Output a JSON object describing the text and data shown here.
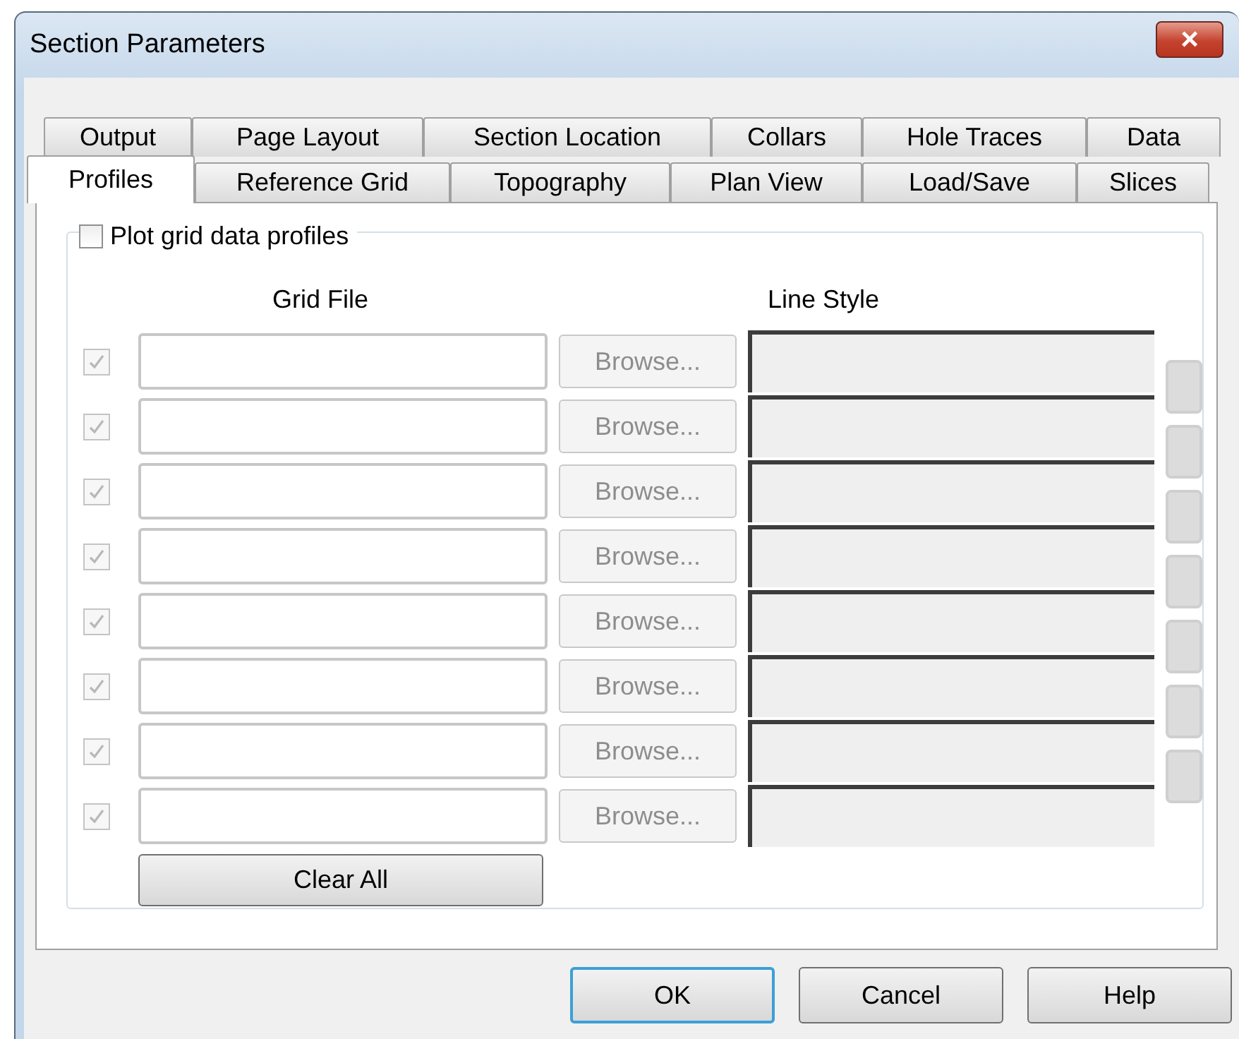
{
  "window": {
    "title": "Section Parameters",
    "close": "×"
  },
  "tab_rows": [
    [
      {
        "label": "Output",
        "selected": false
      },
      {
        "label": "Page Layout",
        "selected": false
      },
      {
        "label": "Section Location",
        "selected": false
      },
      {
        "label": "Collars",
        "selected": false
      },
      {
        "label": "Hole Traces",
        "selected": false
      },
      {
        "label": "Data",
        "selected": false
      }
    ],
    [
      {
        "label": "Profiles",
        "selected": true
      },
      {
        "label": "Reference Grid",
        "selected": false
      },
      {
        "label": "Topography",
        "selected": false
      },
      {
        "label": "Plan View",
        "selected": false
      },
      {
        "label": "Load/Save",
        "selected": false
      },
      {
        "label": "Slices",
        "selected": false
      }
    ]
  ],
  "group": {
    "label": "Plot grid data profiles",
    "checked": false
  },
  "columns": [
    "Grid File",
    "Line Style"
  ],
  "rows": [
    {
      "checked": true,
      "disabled": true,
      "browse": "Browse..."
    },
    {
      "checked": true,
      "disabled": true,
      "browse": "Browse..."
    },
    {
      "checked": true,
      "disabled": true,
      "browse": "Browse..."
    },
    {
      "checked": true,
      "disabled": true,
      "browse": "Browse..."
    },
    {
      "checked": true,
      "disabled": true,
      "browse": "Browse..."
    },
    {
      "checked": true,
      "disabled": true,
      "browse": "Browse..."
    },
    {
      "checked": true,
      "disabled": true,
      "browse": "Browse..."
    },
    {
      "checked": true,
      "disabled": true,
      "browse": "Browse..."
    }
  ],
  "clear_button": "Clear All",
  "buttons": [
    {
      "label": "OK",
      "default": true
    },
    {
      "label": "Cancel",
      "default": false
    },
    {
      "label": "Help",
      "default": false
    }
  ]
}
